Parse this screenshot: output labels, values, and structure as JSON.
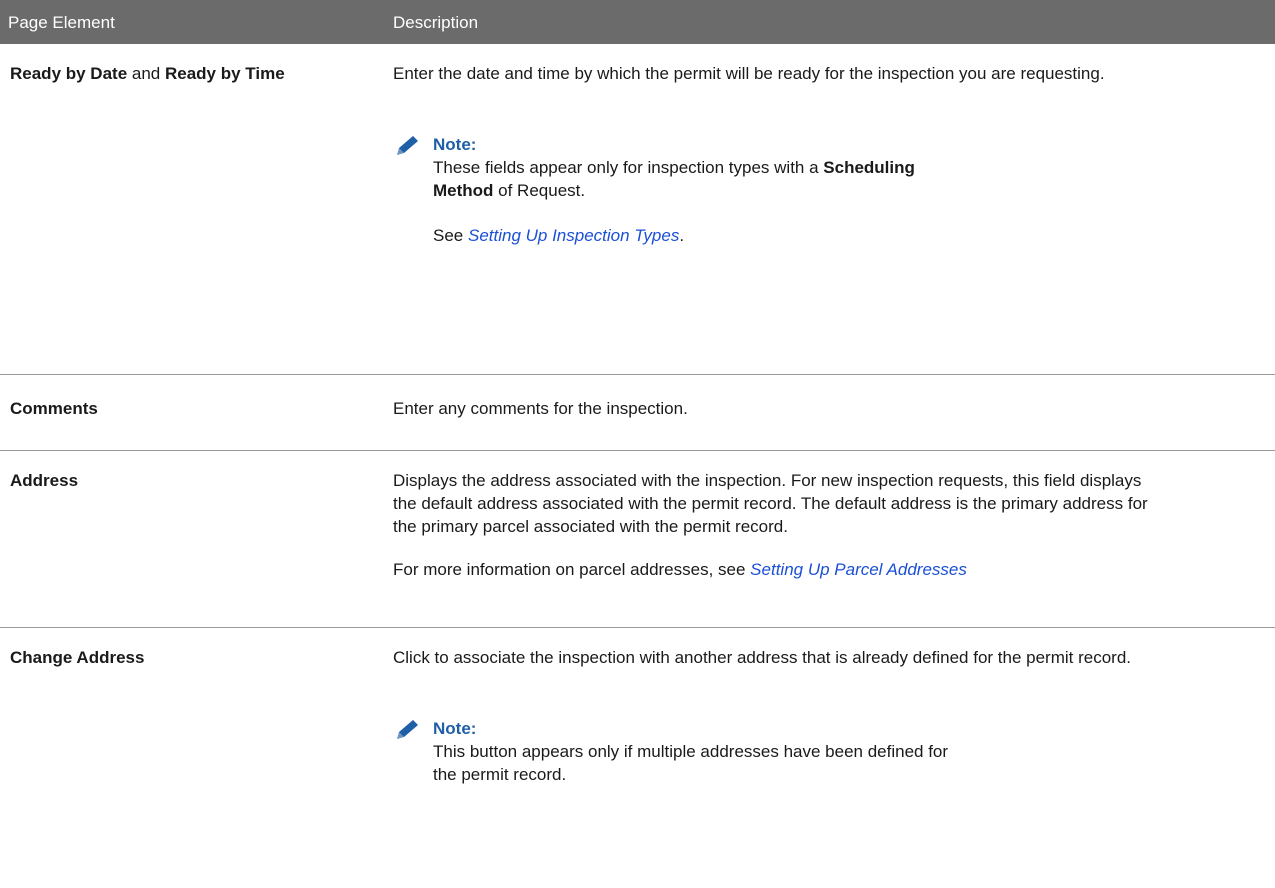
{
  "table": {
    "headers": [
      "Page Element",
      "Description"
    ],
    "rows": [
      {
        "element_parts": [
          {
            "text": "Ready by Date",
            "bold": true
          },
          {
            "text": " and ",
            "bold": false
          },
          {
            "text": "Ready by Time",
            "bold": true
          }
        ],
        "description": "Enter the date and time by which the permit will be ready for the inspection you are requesting.",
        "note": {
          "title": "Note:",
          "text_before": "These fields appear only for inspection types with a ",
          "bold": "Scheduling Method",
          "text_after": " of Request.",
          "see_prefix": "See ",
          "see_link": "Setting Up Inspection Types",
          "see_suffix": "."
        }
      },
      {
        "element": "Comments",
        "description": "Enter any comments for the inspection."
      },
      {
        "element": "Address",
        "description": "Displays the address associated with the inspection. For new inspection requests, this field displays the default address associated with the permit record. The default address is the primary address for the primary parcel associated with the permit record.",
        "more_prefix": "For more information on parcel addresses, see ",
        "more_link": "Setting Up Parcel Addresses"
      },
      {
        "element": "Change Address",
        "description": "Click to associate the inspection with another address that is already defined for the permit record.",
        "note": {
          "title": "Note:",
          "text": "This button appears only if multiple addresses have been defined for the permit record."
        }
      }
    ]
  },
  "colors": {
    "header_bg": "#6b6b6b",
    "link": "#1a4fd6",
    "note_title": "#1f5fa8",
    "pencil": "#1f5fa8"
  },
  "icons": {
    "note": "pencil-icon"
  }
}
